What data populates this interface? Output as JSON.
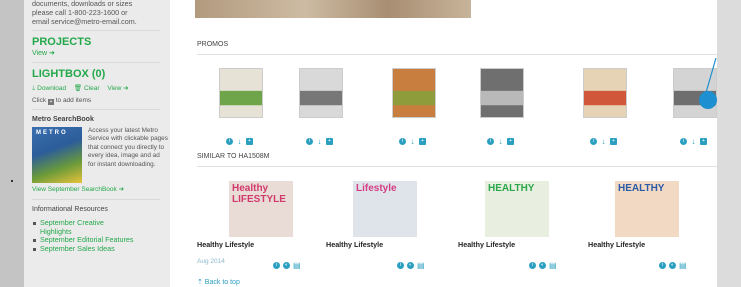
{
  "sidebar": {
    "contact_lines": [
      "documents, downloads or sizes",
      "please call 1-800-223-1600 or",
      "email service@metro-email.com."
    ],
    "projects": {
      "title": "PROJECTS",
      "view": "View ➔"
    },
    "lightbox": {
      "title": "LIGHTBOX (0)",
      "download": "🡓 Download",
      "clear": "🗑 Clear",
      "view": "View ➔",
      "hint_pre": "Click",
      "hint_post": "to add items"
    },
    "searchbook": {
      "heading": "Metro SearchBook",
      "cover_title": "METRO",
      "description": "Access your latest Metro Service with clickable pages that connect you directly to every idea, image and ad for instant downloading.",
      "view_link": "View September SearchBook ➔"
    },
    "resources": {
      "heading": "Informational Resources",
      "items": [
        "September Creative Highlights",
        "September Editorial Features",
        "September Sales Ideas"
      ]
    }
  },
  "main": {
    "promos": {
      "label": "PROMOS",
      "thumbs": [
        {
          "bg": "#e7e2d6",
          "accent": "#6fa54a"
        },
        {
          "bg": "#d9d9d9",
          "accent": "#777777"
        },
        {
          "bg": "#c77e3f",
          "accent": "#8f9c3c"
        },
        {
          "bg": "#6f6f6f",
          "accent": "#b9b9b9"
        },
        {
          "bg": "#e6d2b4",
          "accent": "#d0573a"
        },
        {
          "bg": "#d4d4d4",
          "accent": "#6e6e6e"
        }
      ]
    },
    "similar": {
      "label": "SIMILAR TO HA1508M",
      "items": [
        {
          "title": "Healthy Lifestyle",
          "masthead": "Healthy LIFESTYLE",
          "color": "#d23a6b",
          "bg": "#e9dcd7"
        },
        {
          "title": "Healthy Lifestyle",
          "masthead": "Lifestyle",
          "color": "#d63b83",
          "bg": "#dfe4ea"
        },
        {
          "title": "Healthy Lifestyle",
          "masthead": "HEALTHY",
          "color": "#2aa84a",
          "bg": "#e8efe1"
        },
        {
          "title": "Healthy Lifestyle",
          "masthead": "HEALTHY",
          "color": "#2a5ba8",
          "bg": "#f1d9c4"
        }
      ],
      "date": "Aug 2014"
    },
    "back_to_top": "⇡ Back to top"
  }
}
